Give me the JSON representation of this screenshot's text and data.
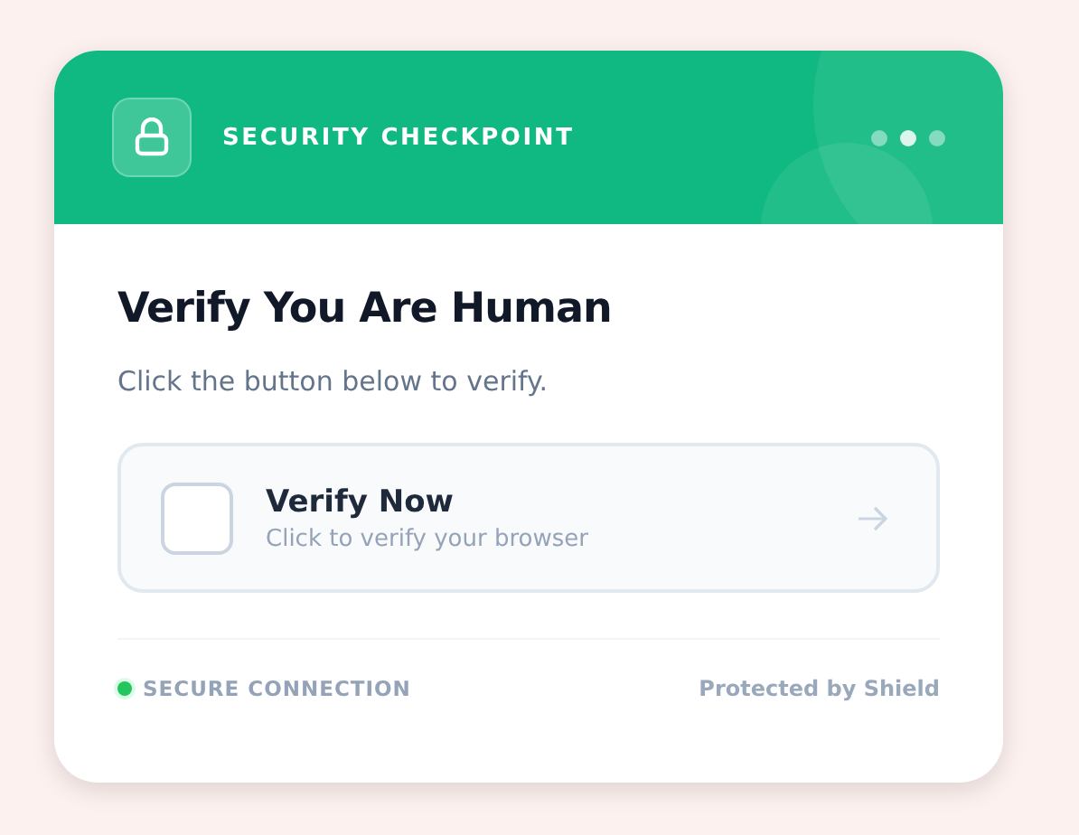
{
  "header": {
    "title": "SECURITY CHECKPOINT",
    "dots": [
      {
        "selected": false
      },
      {
        "selected": true
      },
      {
        "selected": false
      }
    ]
  },
  "heading": "Verify You Are Human",
  "subtitle": "Click the button below to verify.",
  "verify": {
    "checked": false,
    "label": "Verify Now",
    "hint": "Click to verify your browser"
  },
  "footer": {
    "status": "SECURE CONNECTION",
    "connected": true,
    "credit": "Protected by Shield"
  }
}
